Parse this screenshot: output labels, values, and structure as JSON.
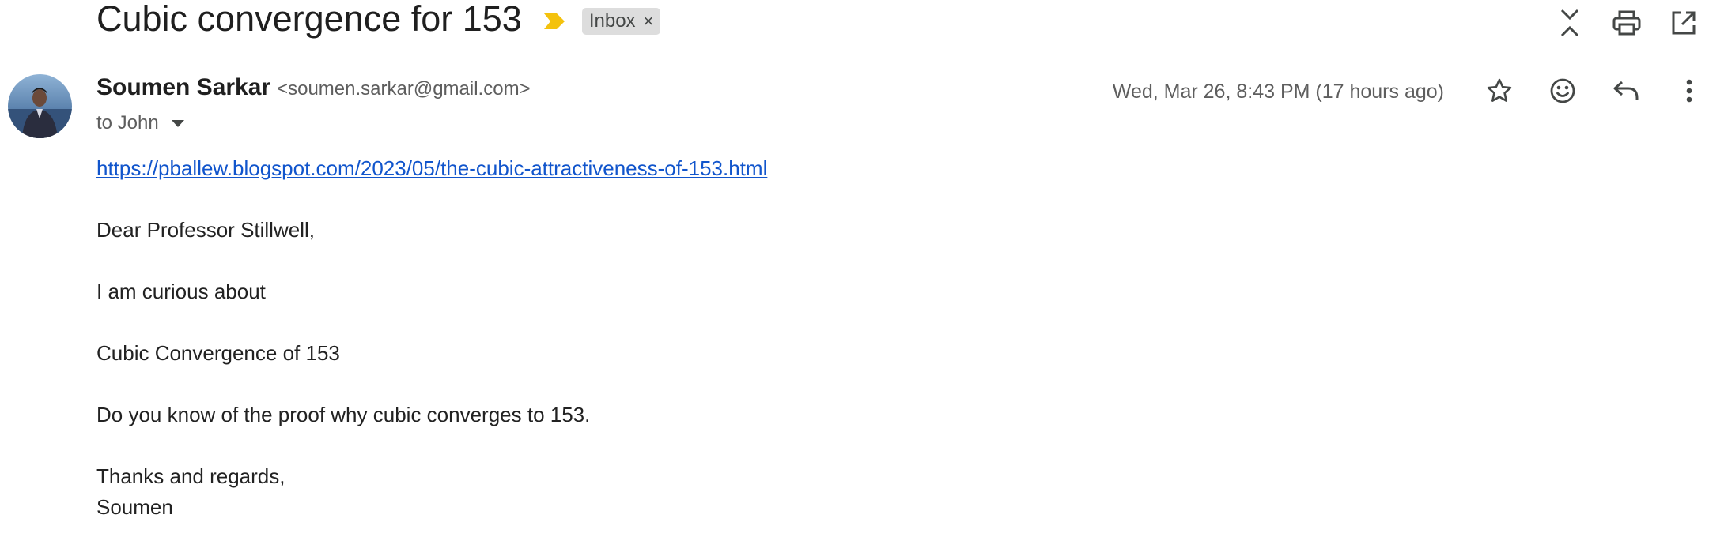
{
  "email": {
    "subject": "Cubic convergence for 153",
    "label": "Inbox",
    "label_close": "×",
    "sender": {
      "name": "Soumen Sarkar",
      "email": "<soumen.sarkar@gmail.com>"
    },
    "recipient": "to John",
    "date": "Wed, Mar 26, 8:43 PM (17 hours ago)",
    "body": {
      "link": "https://pballew.blogspot.com/2023/05/the-cubic-attractiveness-of-153.html",
      "greeting": "Dear Professor Stillwell,",
      "line1": "I am curious about",
      "line2": "Cubic Convergence of 153",
      "line3": "Do you know of the proof why cubic converges to 153.",
      "closing": "Thanks and regards,",
      "signature": "Soumen"
    }
  },
  "icons": {
    "importance": "importance-marker-icon",
    "collapse": "collapse-all-icon",
    "print": "print-icon",
    "open_new_window": "open-in-new-window-icon",
    "star": "star-icon",
    "emoji": "emoji-reaction-icon",
    "reply": "reply-icon",
    "more": "more-vert-icon"
  },
  "colors": {
    "importance": "#f4c20d",
    "link": "#1155cc",
    "chip_bg": "#dddddd"
  }
}
